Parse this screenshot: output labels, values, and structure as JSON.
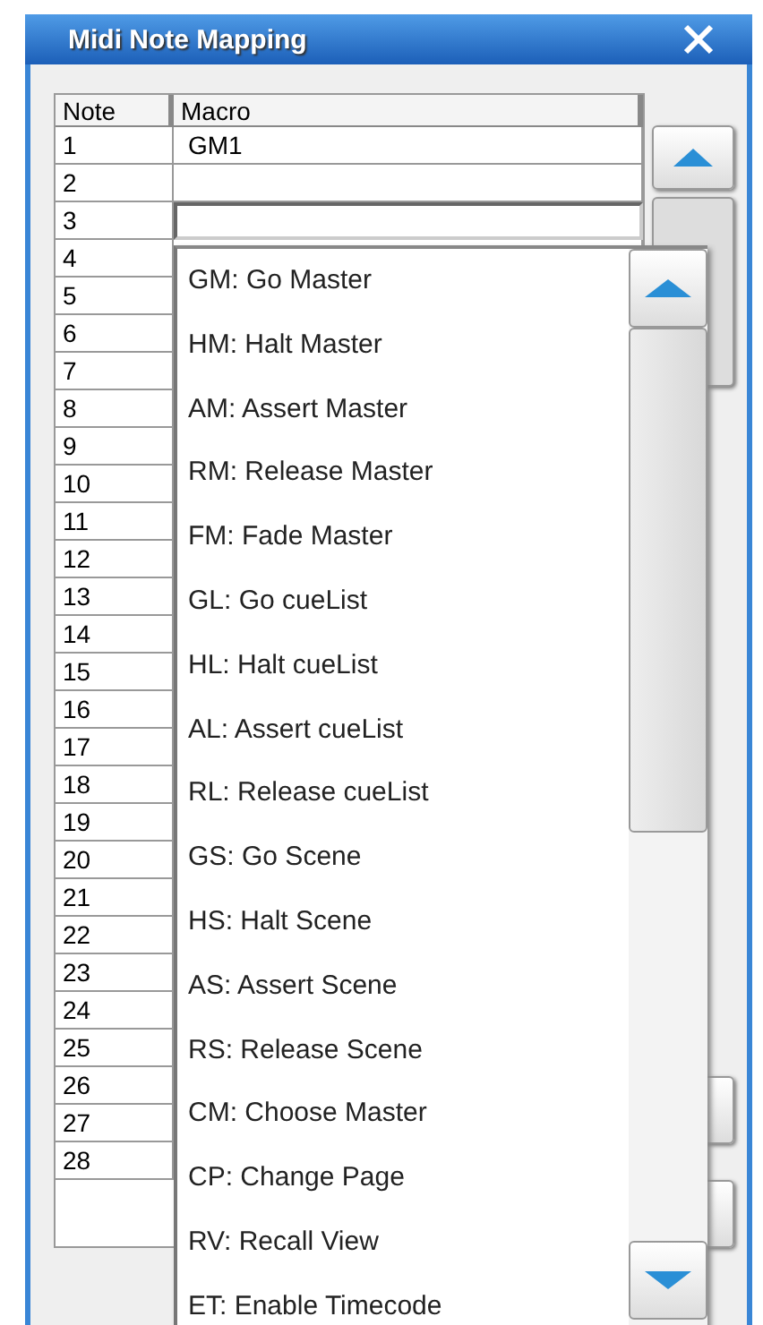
{
  "window": {
    "title": "Midi Note Mapping"
  },
  "table": {
    "columns": [
      "Note",
      "Macro"
    ],
    "rows": [
      {
        "note": "1",
        "macro": "GM1",
        "editing": false
      },
      {
        "note": "2",
        "macro": "",
        "editing": false
      },
      {
        "note": "3",
        "macro": "",
        "editing": true
      },
      {
        "note": "4"
      },
      {
        "note": "5"
      },
      {
        "note": "6"
      },
      {
        "note": "7"
      },
      {
        "note": "8"
      },
      {
        "note": "9"
      },
      {
        "note": "10"
      },
      {
        "note": "11"
      },
      {
        "note": "12"
      },
      {
        "note": "13"
      },
      {
        "note": "14"
      },
      {
        "note": "15"
      },
      {
        "note": "16"
      },
      {
        "note": "17"
      },
      {
        "note": "18"
      },
      {
        "note": "19"
      },
      {
        "note": "20"
      },
      {
        "note": "21"
      },
      {
        "note": "22"
      },
      {
        "note": "23"
      },
      {
        "note": "24"
      },
      {
        "note": "25"
      },
      {
        "note": "26"
      },
      {
        "note": "27"
      },
      {
        "note": "28"
      }
    ]
  },
  "dropdown": {
    "options": [
      "GM: Go Master",
      "HM: Halt Master",
      "AM: Assert Master",
      "RM: Release Master",
      "FM: Fade Master",
      "GL: Go cueList",
      "HL: Halt cueList",
      "AL: Assert cueList",
      "RL: Release cueList",
      "GS: Go Scene",
      "HS: Halt Scene",
      "AS: Assert Scene",
      "RS: Release Scene",
      "CM: Choose Master",
      "CP: Change Page",
      "RV: Recall View",
      "ET: Enable Timecode"
    ]
  }
}
